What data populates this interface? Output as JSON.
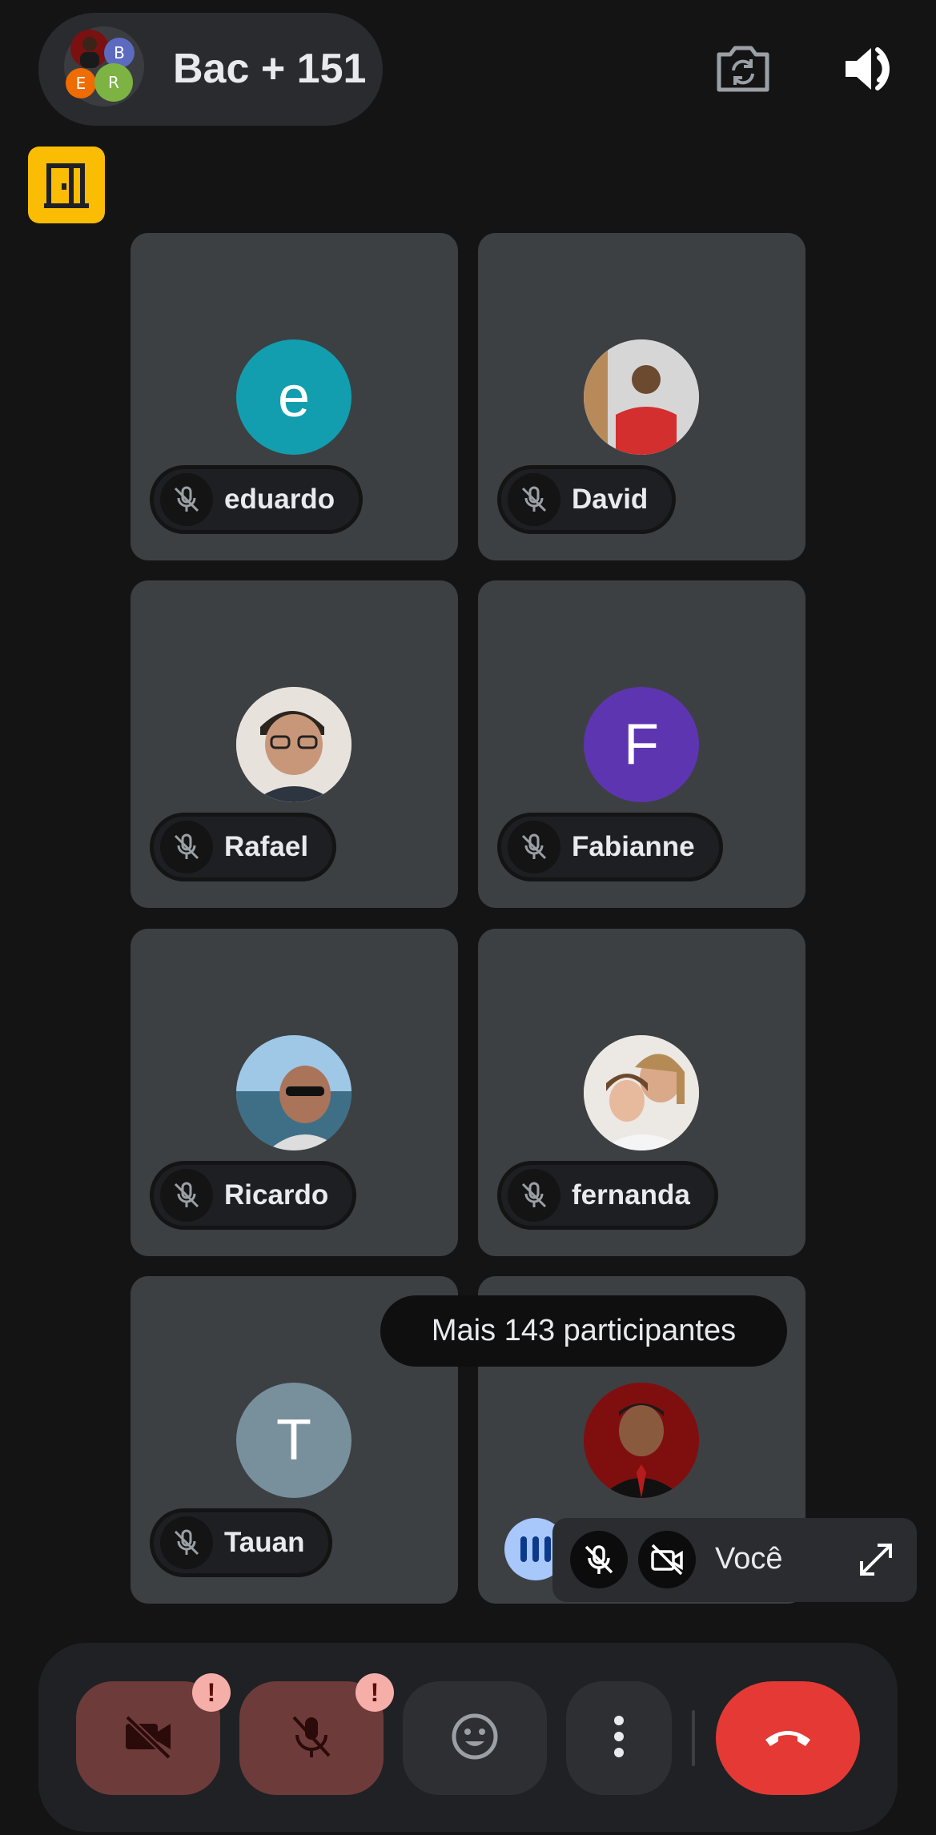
{
  "header": {
    "title": "Bac + 151",
    "avatars": [
      {
        "label": "B",
        "color": "#5c6bc0"
      },
      {
        "label": "E",
        "color": "#ef6c00"
      },
      {
        "label": "R",
        "color": "#7cb342"
      }
    ]
  },
  "tiles": [
    {
      "name": "eduardo",
      "initial": "e",
      "avatar_color": "#129eaf"
    },
    {
      "name": "David",
      "initial": "",
      "avatar_color": "#b9b9b9"
    },
    {
      "name": "Rafael",
      "initial": "",
      "avatar_color": "#9a8f86"
    },
    {
      "name": "Fabianne",
      "initial": "F",
      "avatar_color": "#5e35b1"
    },
    {
      "name": "Ricardo",
      "initial": "",
      "avatar_color": "#6fa3c7"
    },
    {
      "name": "fernanda",
      "initial": "",
      "avatar_color": "#d8c8b8"
    },
    {
      "name": "Tauan",
      "initial": "T",
      "avatar_color": "#78909c"
    },
    {
      "name": "",
      "initial": "",
      "avatar_color": "#8b1111"
    }
  ],
  "more_participants": "Mais 143 participantes",
  "self_view": {
    "label": "Você"
  },
  "colors": {
    "end_call": "#e53935",
    "muted_button": "#6e3b3b",
    "warning_badge": "#f6aea9",
    "room_icon": "#fbbc04"
  }
}
